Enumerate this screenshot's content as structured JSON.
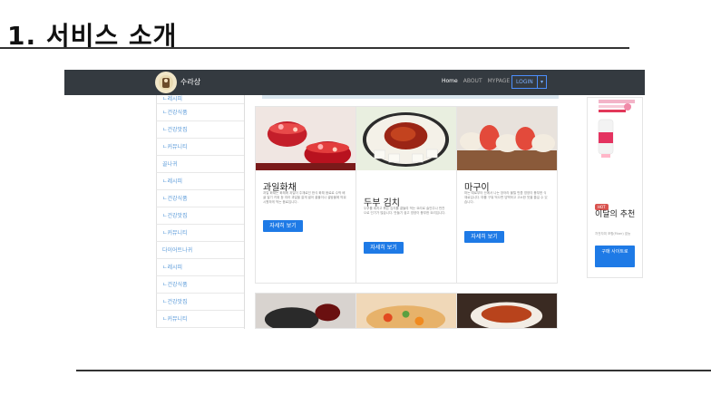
{
  "slide": {
    "title": "1. 서비스 소개"
  },
  "navbar": {
    "brand": "수라상",
    "links": [
      "Home",
      "ABOUT",
      "MYPAGE"
    ],
    "login": "LOGIN",
    "caret": "▾"
  },
  "sidebar": {
    "items": [
      "ㄴ레시피",
      "ㄴ건강식품",
      "ㄴ건강맛집",
      "ㄴ커뮤니티",
      "골나귀",
      "ㄴ레시피",
      "ㄴ건강식품",
      "ㄴ건강맛집",
      "ㄴ커뮤니티",
      "다이어트나귀",
      "ㄴ레시피",
      "ㄴ건강식품",
      "ㄴ건강맛집",
      "ㄴ커뮤니티"
    ]
  },
  "cards": [
    {
      "title": "과일화채",
      "text": "과일 화채는 화채에 과일이 주재료인 한식 화채 음료로 수박 배 귤 딸기 키위 등 여러 과일을 잘게 썰어 꿀물이나 설탕물에 띄워 시원하게 먹는 음료입니다.",
      "button": "자세히 보기"
    },
    {
      "title": "두부 김치",
      "text": "두부를 데치고 볶은 김치를 곁들여 먹는 요리로 술안주나 반찬으로 인기가 많습니다. 만들기 쉽고 영양이 풍부한 요리입니다.",
      "button": "자세히 보기"
    },
    {
      "title": "마구이",
      "text": "마는 예로부터 산에서 나는 장어라 불릴 만큼 영양이 풍부한 식재료입니다. 마를 구워 먹으면 담백하고 고소한 맛을 즐길 수 있습니다.",
      "button": "자세히 보기"
    }
  ],
  "ad": {
    "hot": "HOT",
    "title": "이달의 추천",
    "subtitle": "차전자피 포함(Fiber) 효능",
    "button": "구매 사이트로"
  },
  "colors": {
    "navbar": "#343a40",
    "button": "#1e7ae6",
    "link": "#5a9ad9"
  }
}
